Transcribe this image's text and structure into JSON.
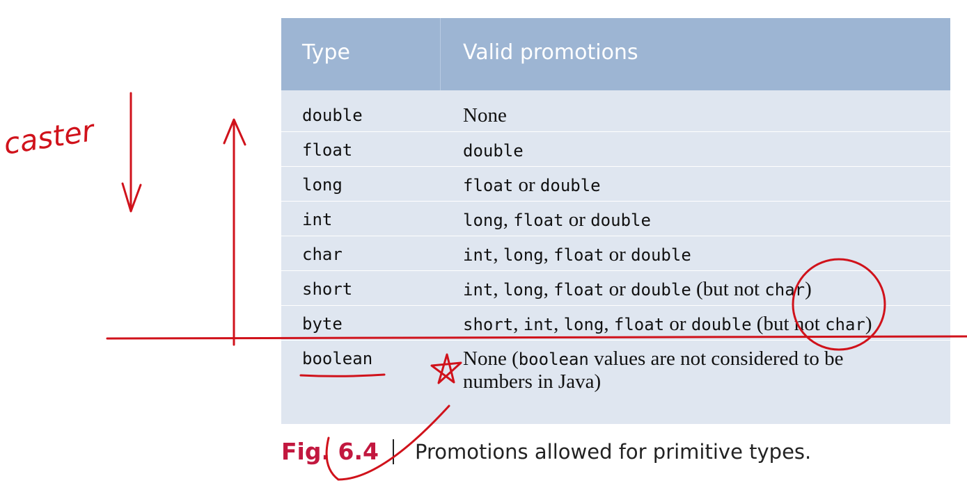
{
  "table": {
    "headers": [
      "Type",
      "Valid promotions"
    ],
    "rows": [
      {
        "type": "double",
        "promotions": [
          {
            "t": "None",
            "m": false
          }
        ]
      },
      {
        "type": "float",
        "promotions": [
          {
            "t": "double",
            "m": true
          }
        ]
      },
      {
        "type": "long",
        "promotions": [
          {
            "t": "float",
            "m": true
          },
          {
            "t": " or ",
            "m": false
          },
          {
            "t": "double",
            "m": true
          }
        ]
      },
      {
        "type": "int",
        "promotions": [
          {
            "t": "long",
            "m": true
          },
          {
            "t": ", ",
            "m": false
          },
          {
            "t": "float",
            "m": true
          },
          {
            "t": " or ",
            "m": false
          },
          {
            "t": "double",
            "m": true
          }
        ]
      },
      {
        "type": "char",
        "promotions": [
          {
            "t": "int",
            "m": true
          },
          {
            "t": ", ",
            "m": false
          },
          {
            "t": "long",
            "m": true
          },
          {
            "t": ", ",
            "m": false
          },
          {
            "t": "float",
            "m": true
          },
          {
            "t": " or ",
            "m": false
          },
          {
            "t": "double",
            "m": true
          }
        ]
      },
      {
        "type": "short",
        "promotions": [
          {
            "t": "int",
            "m": true
          },
          {
            "t": ", ",
            "m": false
          },
          {
            "t": "long",
            "m": true
          },
          {
            "t": ", ",
            "m": false
          },
          {
            "t": "float",
            "m": true
          },
          {
            "t": " or ",
            "m": false
          },
          {
            "t": "double",
            "m": true
          },
          {
            "t": " (but not ",
            "m": false
          },
          {
            "t": "char",
            "m": true
          },
          {
            "t": ")",
            "m": false
          }
        ]
      },
      {
        "type": "byte",
        "promotions": [
          {
            "t": "short",
            "m": true
          },
          {
            "t": ", ",
            "m": false
          },
          {
            "t": "int",
            "m": true
          },
          {
            "t": ", ",
            "m": false
          },
          {
            "t": "long",
            "m": true
          },
          {
            "t": ", ",
            "m": false
          },
          {
            "t": "float",
            "m": true
          },
          {
            "t": " or ",
            "m": false
          },
          {
            "t": "double",
            "m": true
          },
          {
            "t": " (but not ",
            "m": false
          },
          {
            "t": "char",
            "m": true
          },
          {
            "t": ")",
            "m": false
          }
        ]
      },
      {
        "type": "boolean",
        "promotions": [
          {
            "t": "None (",
            "m": false
          },
          {
            "t": "boolean",
            "m": true
          },
          {
            "t": " values are not considered to be",
            "m": false
          },
          {
            "t": "\n",
            "m": false
          },
          {
            "t": "numbers in Java)",
            "m": false
          }
        ]
      }
    ]
  },
  "caption": {
    "fig_label": "Fig. 6.4",
    "text": "Promotions allowed for primitive types."
  },
  "annotations": {
    "handwritten_note": "caster",
    "ink_color": "#d0121b"
  }
}
